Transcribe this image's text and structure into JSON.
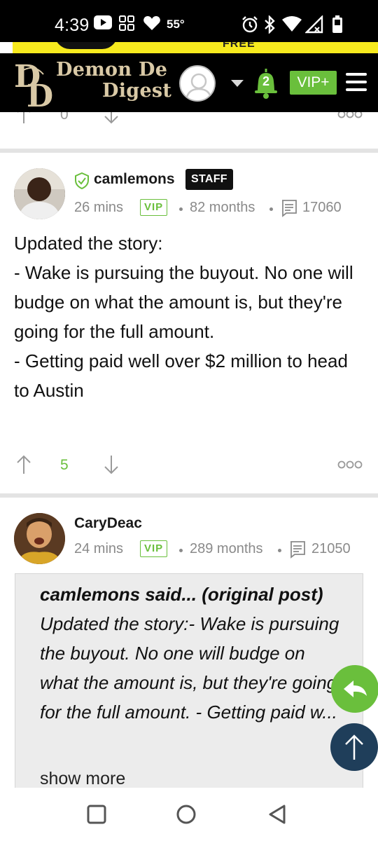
{
  "status_bar": {
    "time": "4:39",
    "temperature": "55°",
    "icons": [
      "youtube-icon",
      "grid-app-icon",
      "heart-icon",
      "alarm-icon",
      "bluetooth-icon",
      "wifi-icon",
      "signal-icon",
      "battery-icon"
    ]
  },
  "ad": {
    "text": "FREE",
    "color": "#f7ea1e"
  },
  "header": {
    "logo_line1": "Demon De",
    "logo_line2": "Digest",
    "notification_count": "2",
    "vip_label": "VIP+",
    "colors": {
      "background": "#000000",
      "logo": "#d9c9a6",
      "accent": "#6abf3c"
    }
  },
  "prev_post": {
    "vote_count": "0"
  },
  "posts": [
    {
      "username": "camlemons",
      "badge": "STAFF",
      "time_ago": "26 mins",
      "tag": "VIP",
      "tenure": "82 months",
      "post_count": "17060",
      "body": "Updated the story:\n- Wake is pursuing the buyout. No one will budge on what the amount is, but they're going for the full amount.\n- Getting paid well over $2 million to head to Austin",
      "vote_count": "5"
    },
    {
      "username": "CaryDeac",
      "time_ago": "24 mins",
      "tag": "VIP",
      "tenure": "289 months",
      "post_count": "21050",
      "quote": {
        "attribution": "camlemons said... (original post)",
        "text": " Updated the story:- Wake is pursuing the buyout. No one will budge on what the amount is, but they're going for the full amount. - Getting paid w...",
        "show_more": "show more"
      }
    }
  ],
  "colors": {
    "vip_green": "#6abf3c",
    "fab_reply": "#6abf3c",
    "fab_top": "#1f3e5a",
    "meta_gray": "#8a8a8a"
  }
}
